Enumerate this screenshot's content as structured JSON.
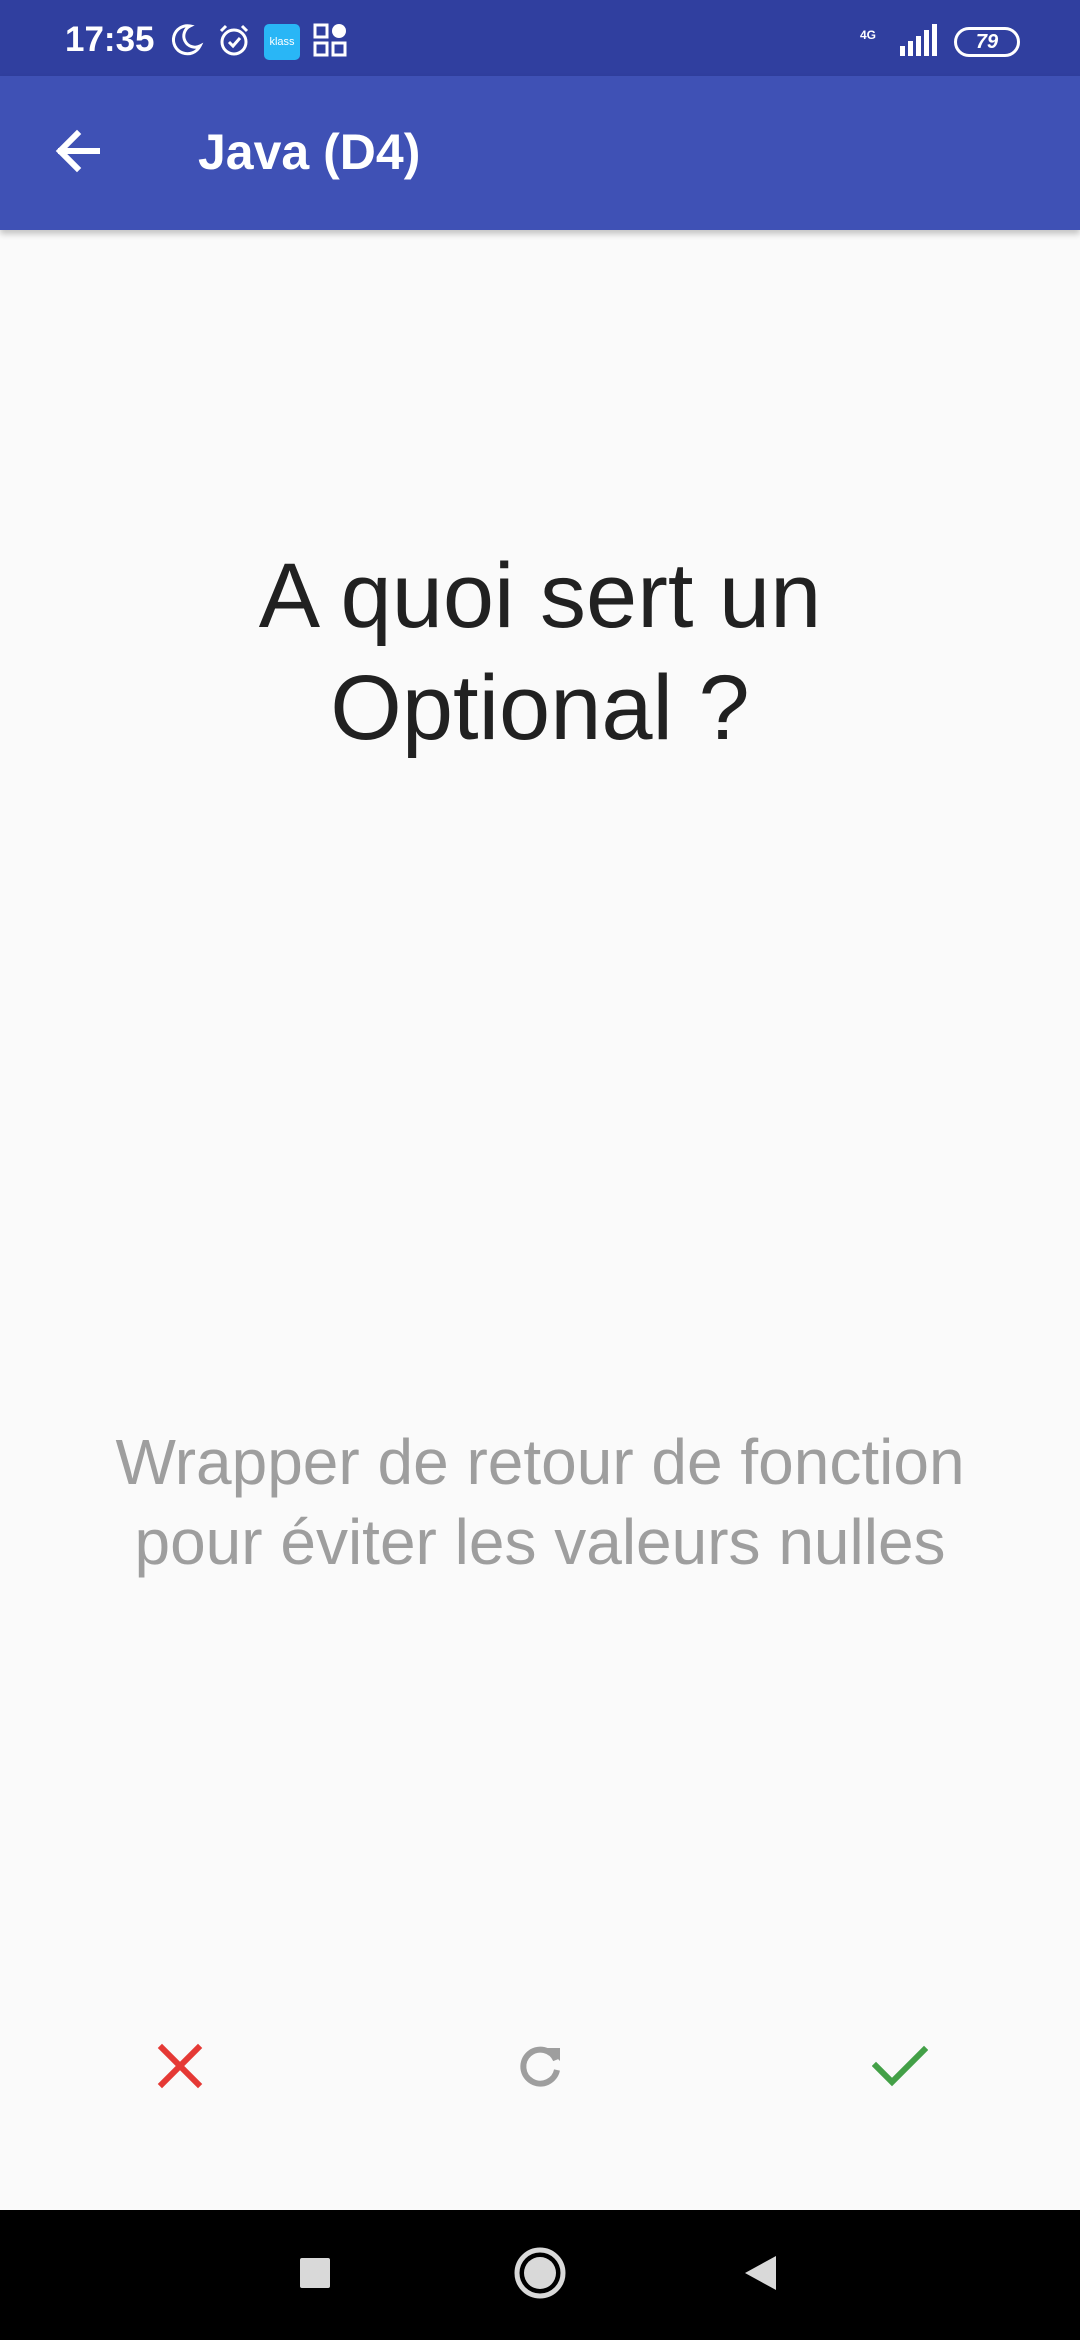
{
  "status_bar": {
    "time": "17:35",
    "notification_icons": [
      "moon-icon",
      "alarm-icon",
      "klass-app-icon",
      "apps-grid-icon"
    ],
    "klass_label": "klass",
    "network_type": "4G",
    "battery_level": "79"
  },
  "app_bar": {
    "back_icon": "arrow-back-icon",
    "title": "Java (D4)"
  },
  "card": {
    "question": "A quoi sert un Optional ?",
    "answer": "Wrapper de retour de fonction pour éviter les valeurs nulles"
  },
  "actions": {
    "wrong_icon": "close-icon",
    "reset_icon": "refresh-icon",
    "right_icon": "check-icon"
  },
  "colors": {
    "status_bar": "#303f9f",
    "app_bar": "#3f51b5",
    "wrong": "#e53935",
    "reset": "#9e9e9e",
    "right": "#43a047",
    "question_text": "#212121",
    "answer_text": "#9e9e9e"
  },
  "nav_bar": {
    "buttons": [
      "recents-icon",
      "home-icon",
      "back-triangle-icon"
    ]
  }
}
